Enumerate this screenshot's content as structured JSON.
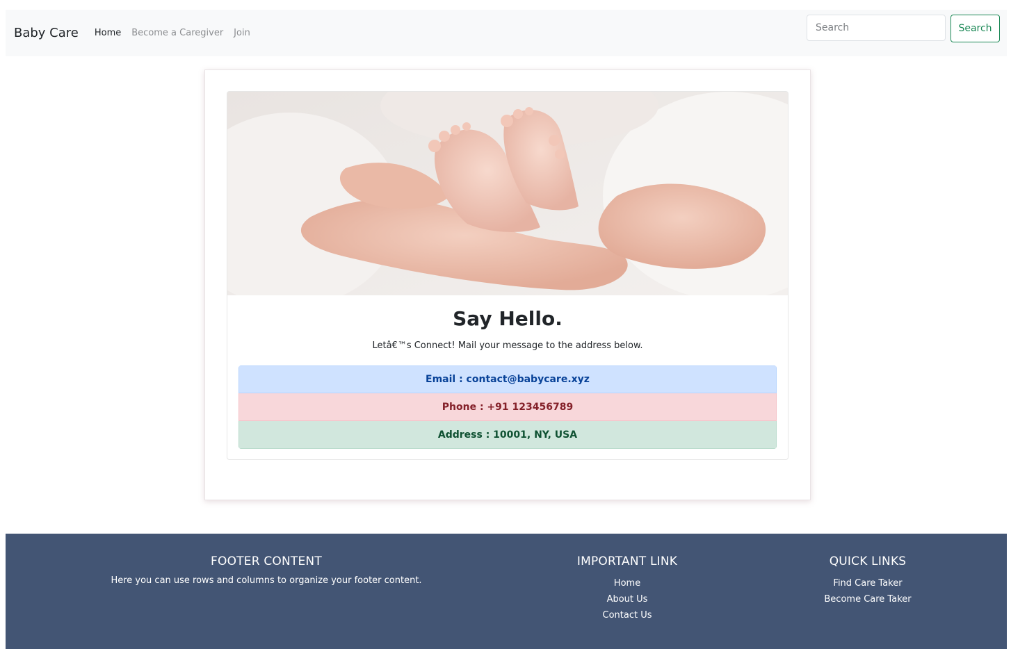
{
  "navbar": {
    "brand": "Baby Care",
    "links": [
      {
        "label": "Home",
        "active": true
      },
      {
        "label": "Become a Caregiver",
        "active": false
      },
      {
        "label": "Join",
        "active": false
      }
    ],
    "search": {
      "placeholder": "Search",
      "button_label": "Search"
    }
  },
  "main": {
    "hero_image": "baby-feet-in-hands-photo",
    "title": "Say Hello.",
    "subtitle": "Letâ€™s Connect! Mail your message to the address below.",
    "contacts": {
      "email": "Email : contact@babycare.xyz",
      "phone": "Phone : +91 123456789",
      "address": "Address : 10001, NY, USA"
    }
  },
  "footer": {
    "content": {
      "heading": "FOOTER CONTENT",
      "text": "Here you can use rows and columns to organize your footer content."
    },
    "important_links": {
      "heading": "IMPORTANT LINK",
      "items": [
        "Home",
        "About Us",
        "Contact Us"
      ]
    },
    "quick_links": {
      "heading": "QUICK LINKS",
      "items": [
        "Find Care Taker",
        "Become Care Taker"
      ]
    }
  },
  "colors": {
    "navbar_bg": "#f8f9fa",
    "footer_bg": "#435574",
    "search_button": "#198754",
    "email_bg": "#cfe2ff",
    "phone_bg": "#f8d7da",
    "address_bg": "#d1e7dd"
  }
}
